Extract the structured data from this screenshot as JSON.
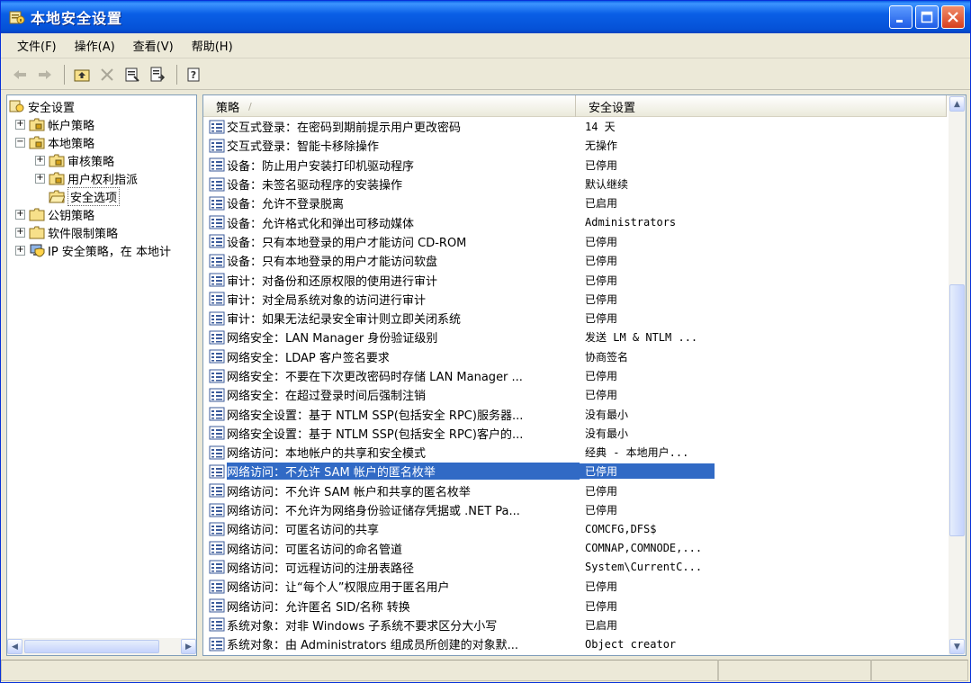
{
  "window": {
    "title": "本地安全设置"
  },
  "menu": [
    {
      "label": "文件(F)"
    },
    {
      "label": "操作(A)"
    },
    {
      "label": "查看(V)"
    },
    {
      "label": "帮助(H)"
    }
  ],
  "toolbar": [
    "back-icon",
    "forward-icon",
    "up-folder-icon",
    "delete-icon",
    "properties-icon",
    "export-icon",
    "help-icon"
  ],
  "tree": {
    "root": "安全设置",
    "nodes": [
      {
        "label": "帐户策略",
        "expander": "+",
        "level": 1
      },
      {
        "label": "本地策略",
        "expander": "−",
        "level": 1
      },
      {
        "label": "审核策略",
        "expander": "+",
        "level": 2
      },
      {
        "label": "用户权利指派",
        "expander": "+",
        "level": 2
      },
      {
        "label": "安全选项",
        "expander": "",
        "level": 2,
        "selected": true
      },
      {
        "label": "公钥策略",
        "expander": "+",
        "level": 1
      },
      {
        "label": "软件限制策略",
        "expander": "+",
        "level": 1
      },
      {
        "label": "IP 安全策略，在 本地计",
        "expander": "+",
        "level": 1
      }
    ]
  },
  "list": {
    "col_policy": "策略",
    "col_setting": "安全设置",
    "sort_indicator": "/",
    "rows": [
      {
        "policy": "交互式登录：在密码到期前提示用户更改密码",
        "value": "14 天"
      },
      {
        "policy": "交互式登录：智能卡移除操作",
        "value": "无操作"
      },
      {
        "policy": "设备：防止用户安装打印机驱动程序",
        "value": "已停用"
      },
      {
        "policy": "设备：未签名驱动程序的安装操作",
        "value": "默认继续"
      },
      {
        "policy": "设备：允许不登录脱离",
        "value": "已启用"
      },
      {
        "policy": "设备：允许格式化和弹出可移动媒体",
        "value": "Administrators"
      },
      {
        "policy": "设备：只有本地登录的用户才能访问 CD-ROM",
        "value": "已停用"
      },
      {
        "policy": "设备：只有本地登录的用户才能访问软盘",
        "value": "已停用"
      },
      {
        "policy": "审计：对备份和还原权限的使用进行审计",
        "value": "已停用"
      },
      {
        "policy": "审计：对全局系统对象的访问进行审计",
        "value": "已停用"
      },
      {
        "policy": "审计：如果无法纪录安全审计则立即关闭系统",
        "value": "已停用"
      },
      {
        "policy": "网络安全：LAN Manager 身份验证级别",
        "value": "发送 LM & NTLM ..."
      },
      {
        "policy": "网络安全：LDAP 客户签名要求",
        "value": "协商签名"
      },
      {
        "policy": "网络安全：不要在下次更改密码时存储 LAN Manager ...",
        "value": "已停用"
      },
      {
        "policy": "网络安全：在超过登录时间后强制注销",
        "value": "已停用"
      },
      {
        "policy": "网络安全设置：基于 NTLM SSP(包括安全 RPC)服务器...",
        "value": "没有最小"
      },
      {
        "policy": "网络安全设置：基于 NTLM SSP(包括安全 RPC)客户的...",
        "value": "没有最小"
      },
      {
        "policy": "网络访问：本地帐户的共享和安全模式",
        "value": "经典 - 本地用户..."
      },
      {
        "policy": "网络访问：不允许 SAM 帐户的匿名枚举",
        "value": "已停用",
        "selected": true
      },
      {
        "policy": "网络访问：不允许 SAM 帐户和共享的匿名枚举",
        "value": "已停用"
      },
      {
        "policy": "网络访问：不允许为网络身份验证储存凭据或 .NET Pa...",
        "value": "已停用"
      },
      {
        "policy": "网络访问：可匿名访问的共享",
        "value": "COMCFG,DFS$"
      },
      {
        "policy": "网络访问：可匿名访问的命名管道",
        "value": "COMNAP,COMNODE,..."
      },
      {
        "policy": "网络访问：可远程访问的注册表路径",
        "value": "System\\CurrentC..."
      },
      {
        "policy": "网络访问：让“每个人”权限应用于匿名用户",
        "value": "已停用"
      },
      {
        "policy": "网络访问：允许匿名 SID/名称 转换",
        "value": "已停用"
      },
      {
        "policy": "系统对象：对非 Windows 子系统不要求区分大小写",
        "value": "已启用"
      },
      {
        "policy": "系统对象：由 Administrators 组成员所创建的对象默...",
        "value": "Object creator"
      }
    ]
  },
  "colors": {
    "titlebar": "#0a5fe6",
    "selection": "#316ac5",
    "chrome": "#ece9d8"
  }
}
